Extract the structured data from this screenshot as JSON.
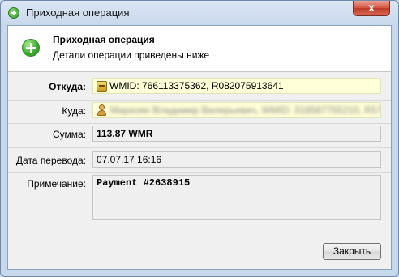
{
  "window": {
    "title": "Приходная операция",
    "close_glyph": "x"
  },
  "header": {
    "title": "Приходная операция",
    "subtitle": "Детали операции приведены ниже",
    "icon": "green-plus-icon"
  },
  "fields": {
    "from": {
      "label": "Откуда:",
      "value": "WMID: 766113375362, R082075913641",
      "icon": "wallet-icon"
    },
    "to": {
      "label": "Куда:",
      "value": "Мирхоян Владимир Валерьевич, WMID: 318587755210, R5789731...",
      "icon": "person-icon"
    },
    "amount": {
      "label": "Сумма:",
      "value": "113.87 WMR"
    },
    "date": {
      "label": "Дата перевода:",
      "value": "07.07.17 16:16"
    },
    "note": {
      "label": "Примечание:",
      "value": "Payment  #2638915"
    }
  },
  "buttons": {
    "close_label": "Закрыть"
  }
}
